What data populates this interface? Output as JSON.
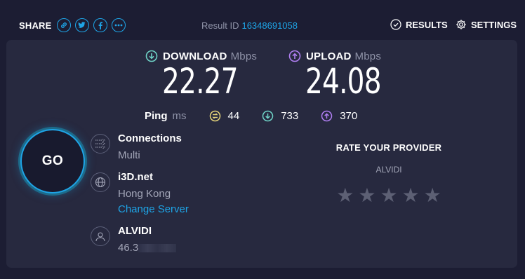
{
  "top": {
    "share_label": "SHARE",
    "share_buttons": [
      "link-icon",
      "twitter-icon",
      "facebook-icon",
      "more-icon"
    ],
    "result_id_label": "Result ID",
    "result_id": "16348691058",
    "results_label": "RESULTS",
    "settings_label": "SETTINGS"
  },
  "download": {
    "label": "DOWNLOAD",
    "unit": "Mbps",
    "value": "22.27"
  },
  "upload": {
    "label": "UPLOAD",
    "unit": "Mbps",
    "value": "24.08"
  },
  "ping": {
    "label": "Ping",
    "unit": "ms",
    "idle": "44",
    "download": "733",
    "upload": "370"
  },
  "go_label": "GO",
  "connections": {
    "label": "Connections",
    "value": "Multi"
  },
  "server": {
    "name": "i3D.net",
    "location": "Hong Kong",
    "change": "Change Server"
  },
  "isp": {
    "name": "ALVIDI",
    "ip_partial": "46.3"
  },
  "rating": {
    "title": "RATE YOUR PROVIDER",
    "provider": "ALVIDI",
    "stars": 5
  },
  "colors": {
    "accent": "#1ea4e6",
    "download": "#6fd3c7",
    "upload": "#b07ff2",
    "idle": "#e6d57a"
  }
}
